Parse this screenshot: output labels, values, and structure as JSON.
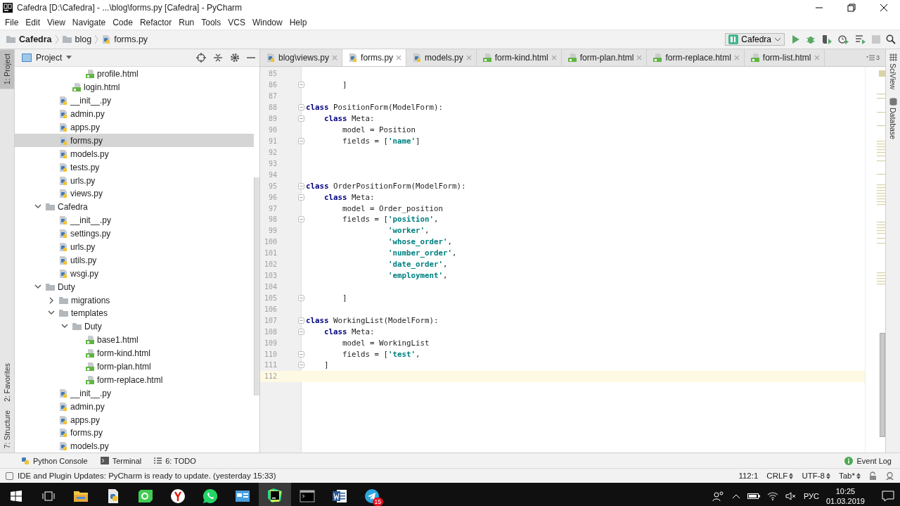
{
  "window": {
    "title": "Cafedra [D:\\Cafedra] - ...\\blog\\forms.py [Cafedra] - PyCharm"
  },
  "menu": [
    "File",
    "Edit",
    "View",
    "Navigate",
    "Code",
    "Refactor",
    "Run",
    "Tools",
    "VCS",
    "Window",
    "Help"
  ],
  "breadcrumb": [
    {
      "label": "Cafedra",
      "kind": "project"
    },
    {
      "label": "blog",
      "kind": "folder"
    },
    {
      "label": "forms.py",
      "kind": "py"
    }
  ],
  "run_config": {
    "label": "Cafedra"
  },
  "left_tools": [
    {
      "label": "1: Project",
      "selected": true
    },
    {
      "label": "2: Favorites",
      "selected": false
    },
    {
      "label": "7: Structure",
      "selected": false
    }
  ],
  "project_panel": {
    "title": "Project",
    "tree": [
      {
        "children": [
          {
            "children": [
              {
                "children": [
                  {
                    "name": "profile.html",
                    "kind": "html",
                    "selected": false
                  }
                ]
              },
              {
                "name": "login.html",
                "kind": "html",
                "selected": false
              }
            ]
          },
          {
            "name": "__init__.py",
            "kind": "py",
            "selected": false
          },
          {
            "name": "admin.py",
            "kind": "py",
            "selected": false
          },
          {
            "name": "apps.py",
            "kind": "py",
            "selected": false
          },
          {
            "name": "forms.py",
            "kind": "py",
            "selected": true
          },
          {
            "name": "models.py",
            "kind": "py",
            "selected": false
          },
          {
            "name": "tests.py",
            "kind": "py",
            "selected": false
          },
          {
            "name": "urls.py",
            "kind": "py",
            "selected": false
          },
          {
            "name": "views.py",
            "kind": "py",
            "selected": false
          }
        ]
      },
      {
        "name": "Cafedra",
        "kind": "folder",
        "selected": false,
        "expanded": true,
        "children": [
          {
            "name": "__init__.py",
            "kind": "py",
            "selected": false
          },
          {
            "name": "settings.py",
            "kind": "py",
            "selected": false
          },
          {
            "name": "urls.py",
            "kind": "py",
            "selected": false
          },
          {
            "name": "utils.py",
            "kind": "py",
            "selected": false
          },
          {
            "name": "wsgi.py",
            "kind": "py",
            "selected": false
          }
        ]
      },
      {
        "name": "Duty",
        "kind": "folder",
        "selected": false,
        "expanded": true,
        "children": [
          {
            "name": "migrations",
            "kind": "folder",
            "selected": false,
            "expanded": false
          },
          {
            "name": "templates",
            "kind": "folder",
            "selected": false,
            "expanded": true,
            "children": [
              {
                "name": "Duty",
                "kind": "folder",
                "selected": false,
                "expanded": true,
                "children": [
                  {
                    "name": "base1.html",
                    "kind": "html",
                    "selected": false
                  },
                  {
                    "name": "form-kind.html",
                    "kind": "html",
                    "selected": false
                  },
                  {
                    "name": "form-plan.html",
                    "kind": "html",
                    "selected": false
                  },
                  {
                    "name": "form-replace.html",
                    "kind": "html",
                    "selected": false
                  }
                ]
              }
            ]
          },
          {
            "name": "__init__.py",
            "kind": "py",
            "selected": false
          },
          {
            "name": "admin.py",
            "kind": "py",
            "selected": false
          },
          {
            "name": "apps.py",
            "kind": "py",
            "selected": false
          },
          {
            "name": "forms.py",
            "kind": "py",
            "selected": false
          },
          {
            "name": "models.py",
            "kind": "py",
            "selected": false
          }
        ]
      }
    ]
  },
  "editor_tabs": [
    {
      "label": "blog\\views.py",
      "kind": "py",
      "selected": false
    },
    {
      "label": "forms.py",
      "kind": "py",
      "selected": true
    },
    {
      "label": "models.py",
      "kind": "py",
      "selected": false
    },
    {
      "label": "form-kind.html",
      "kind": "html",
      "selected": false
    },
    {
      "label": "form-plan.html",
      "kind": "html",
      "selected": false
    },
    {
      "label": "form-replace.html",
      "kind": "html",
      "selected": false
    },
    {
      "label": "form-list.html",
      "kind": "html",
      "selected": false
    }
  ],
  "hidden_tabs_count": "3",
  "code": [
    {
      "number": "85",
      "fold": false,
      "current": false
    },
    {
      "number": "86",
      "fold": true,
      "current": false,
      "tokens": [
        {
          "kind": "plain",
          "text": "        ]"
        }
      ]
    },
    {
      "number": "87",
      "fold": false,
      "current": false
    },
    {
      "number": "88",
      "fold": true,
      "current": false,
      "tokens": [
        {
          "kind": "kw",
          "text": "class"
        },
        {
          "kind": "plain",
          "text": " PositionForm(ModelForm):"
        }
      ]
    },
    {
      "number": "89",
      "fold": true,
      "current": false,
      "tokens": [
        {
          "kind": "kw",
          "text": "    class"
        },
        {
          "kind": "plain",
          "text": " Meta:"
        }
      ]
    },
    {
      "number": "90",
      "fold": false,
      "current": false,
      "tokens": [
        {
          "kind": "plain",
          "text": "        model = Position"
        }
      ]
    },
    {
      "number": "91",
      "fold": true,
      "current": false,
      "tokens": [
        {
          "kind": "plain",
          "text": "        fields = ["
        },
        {
          "kind": "str",
          "text": "'name'"
        },
        {
          "kind": "plain",
          "text": "]"
        }
      ]
    },
    {
      "number": "92",
      "fold": false,
      "current": false
    },
    {
      "number": "93",
      "fold": false,
      "current": false
    },
    {
      "number": "94",
      "fold": false,
      "current": false
    },
    {
      "number": "95",
      "fold": true,
      "current": false,
      "tokens": [
        {
          "kind": "kw",
          "text": "class"
        },
        {
          "kind": "plain",
          "text": " OrderPositionForm(ModelForm):"
        }
      ]
    },
    {
      "number": "96",
      "fold": true,
      "current": false,
      "tokens": [
        {
          "kind": "kw",
          "text": "    class"
        },
        {
          "kind": "plain",
          "text": " Meta:"
        }
      ]
    },
    {
      "number": "97",
      "fold": false,
      "current": false,
      "tokens": [
        {
          "kind": "plain",
          "text": "        model = Order_position"
        }
      ]
    },
    {
      "number": "98",
      "fold": true,
      "current": false,
      "tokens": [
        {
          "kind": "plain",
          "text": "        fields = ["
        },
        {
          "kind": "str",
          "text": "'position'"
        },
        {
          "kind": "plain",
          "text": ","
        }
      ]
    },
    {
      "number": "99",
      "fold": false,
      "current": false,
      "tokens": [
        {
          "kind": "str",
          "text": "                  'worker'"
        },
        {
          "kind": "plain",
          "text": ","
        }
      ]
    },
    {
      "number": "100",
      "fold": false,
      "current": false,
      "tokens": [
        {
          "kind": "str",
          "text": "                  'whose_order'"
        },
        {
          "kind": "plain",
          "text": ","
        }
      ]
    },
    {
      "number": "101",
      "fold": false,
      "current": false,
      "tokens": [
        {
          "kind": "str",
          "text": "                  'number_order'"
        },
        {
          "kind": "plain",
          "text": ","
        }
      ]
    },
    {
      "number": "102",
      "fold": false,
      "current": false,
      "tokens": [
        {
          "kind": "str",
          "text": "                  'date_order'"
        },
        {
          "kind": "plain",
          "text": ","
        }
      ]
    },
    {
      "number": "103",
      "fold": false,
      "current": false,
      "tokens": [
        {
          "kind": "str",
          "text": "                  'employment'"
        },
        {
          "kind": "plain",
          "text": ","
        }
      ]
    },
    {
      "number": "104",
      "fold": false,
      "current": false
    },
    {
      "number": "105",
      "fold": true,
      "current": false,
      "tokens": [
        {
          "kind": "plain",
          "text": "        ]"
        }
      ]
    },
    {
      "number": "106",
      "fold": false,
      "current": false
    },
    {
      "number": "107",
      "fold": true,
      "current": false,
      "tokens": [
        {
          "kind": "kw",
          "text": "class"
        },
        {
          "kind": "plain",
          "text": " WorkingList(ModelForm):"
        }
      ]
    },
    {
      "number": "108",
      "fold": true,
      "current": false,
      "tokens": [
        {
          "kind": "kw",
          "text": "    class"
        },
        {
          "kind": "plain",
          "text": " Meta:"
        }
      ]
    },
    {
      "number": "109",
      "fold": false,
      "current": false,
      "tokens": [
        {
          "kind": "plain",
          "text": "        model = WorkingList"
        }
      ]
    },
    {
      "number": "110",
      "fold": true,
      "current": false,
      "tokens": [
        {
          "kind": "plain",
          "text": "        fields = ["
        },
        {
          "kind": "str",
          "text": "'test'"
        },
        {
          "kind": "plain",
          "text": ","
        }
      ]
    },
    {
      "number": "111",
      "fold": true,
      "current": false,
      "tokens": [
        {
          "kind": "plain",
          "text": "    ]"
        }
      ]
    },
    {
      "number": "112",
      "fold": false,
      "current": true
    }
  ],
  "right_tools": [
    "SciView",
    "Database"
  ],
  "bottom_tools": [
    {
      "label": "Python Console",
      "kind": "console"
    },
    {
      "label": "Terminal",
      "kind": "terminal"
    },
    {
      "label": "6: TODO",
      "kind": "todo"
    }
  ],
  "event_log": "Event Log",
  "status": {
    "message": "IDE and Plugin Updates: PyCharm is ready to update. (yesterday 15:33)",
    "position": "112:1",
    "line_separator": "CRLF",
    "encoding": "UTF-8",
    "indent": "Tab*"
  },
  "taskbar": {
    "apps": [
      {
        "kind": "explorer",
        "active": false
      },
      {
        "kind": "python",
        "active": false
      },
      {
        "kind": "qt",
        "active": false
      },
      {
        "kind": "yandex",
        "active": false
      },
      {
        "kind": "whatsapp",
        "active": false
      },
      {
        "kind": "window",
        "active": false
      },
      {
        "kind": "pycharm",
        "active": true
      },
      {
        "kind": "terminal",
        "active": false
      },
      {
        "kind": "word",
        "active": false
      },
      {
        "kind": "telegram",
        "active": false,
        "badge": "15"
      }
    ],
    "language": "РУС",
    "time": "10:25",
    "date": "01.03.2019"
  }
}
